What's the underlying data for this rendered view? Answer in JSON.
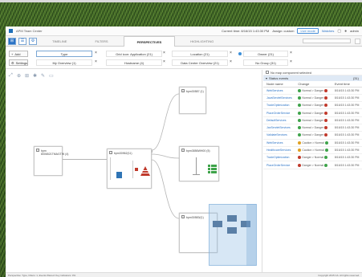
{
  "app": {
    "title": "APM Team Center",
    "current_time": "Current time: 8/16/15 1:43:30 PM",
    "assign_label": "Assign: custom",
    "live_button": "Live mode",
    "watches_link": "Watches",
    "user_label": "admin"
  },
  "tabs": [
    {
      "label": "Timeline",
      "active": false
    },
    {
      "label": "Filters",
      "active": false
    },
    {
      "label": "Perspectives",
      "active": true
    },
    {
      "label": "Highlighting",
      "active": false
    }
  ],
  "filters": {
    "add_label": "Add",
    "settings_label": "Settings",
    "row1": [
      "Type",
      "Grid icon: Application (21)",
      "Location (21)",
      "Owner (21)"
    ],
    "row2": [
      "My Overview (1)",
      "Hostname (4)",
      "Data Center Overview (21)",
      "No Group (31)"
    ]
  },
  "canvas": {
    "nodes": [
      {
        "label": "bpm\n8006521TMAGTW (4)"
      },
      {
        "label": "bpm30962(11)"
      },
      {
        "label": "bpm30587 (1)"
      },
      {
        "label": "bpm3856WH00 (5)"
      },
      {
        "label": "bpm30583/(1)"
      }
    ]
  },
  "panel": {
    "no_map_label": "No map component selected",
    "status_label": "Status events",
    "status_count": "(31)",
    "columns": [
      "Node name",
      "Change",
      "Event time"
    ],
    "rows": [
      {
        "name": "WebServices",
        "change": "Normal > Danger",
        "time": "8/16/15 1:43:30 PM",
        "from": "#3ea34a",
        "to": "#c0392b"
      },
      {
        "name": "JavaServletServices",
        "change": "Normal > Danger",
        "time": "8/16/15 1:43:30 PM",
        "from": "#3ea34a",
        "to": "#c0392b"
      },
      {
        "name": "TradeOptimization",
        "change": "Normal > Danger",
        "time": "8/16/15 1:43:30 PM",
        "from": "#3ea34a",
        "to": "#c0392b"
      },
      {
        "name": "PlaceOrderService",
        "change": "Normal > Danger",
        "time": "8/16/15 1:43:30 PM",
        "from": "#3ea34a",
        "to": "#c0392b"
      },
      {
        "name": "DefaultServices",
        "change": "Normal > Danger",
        "time": "8/16/15 1:43:30 PM",
        "from": "#3ea34a",
        "to": "#c0392b"
      },
      {
        "name": "JaxServletServices",
        "change": "Normal > Danger",
        "time": "8/16/15 1:43:30 PM",
        "from": "#3ea34a",
        "to": "#c0392b"
      },
      {
        "name": "ValidateServices",
        "change": "Normal > Danger",
        "time": "8/16/15 1:43:30 PM",
        "from": "#3ea34a",
        "to": "#c0392b"
      },
      {
        "name": "WebServices",
        "change": "Caution > Normal",
        "time": "8/16/15 1:43:30 PM",
        "from": "#e0a020",
        "to": "#3ea34a"
      },
      {
        "name": "HealthcareServices",
        "change": "Caution > Normal",
        "time": "8/16/15 1:43:30 PM",
        "from": "#e0a020",
        "to": "#3ea34a"
      },
      {
        "name": "TradeOptimization",
        "change": "Danger > Normal",
        "time": "8/16/15 1:43:30 PM",
        "from": "#c0392b",
        "to": "#3ea34a"
      },
      {
        "name": "PlaceOrderService",
        "change": "Danger > Normal",
        "time": "8/16/15 1:43:30 PM",
        "from": "#c0392b",
        "to": "#3ea34a"
      }
    ]
  },
  "statusline": {
    "left": "Perspective: Type, Filters: 1, Events filtered: Key indicators: 0%",
    "right": "Copyright 2015 CA. All rights reserved."
  },
  "colors": {
    "accent": "#2b73c6",
    "normal": "#3ea34a",
    "danger": "#c0392b",
    "caution": "#e0a020"
  }
}
